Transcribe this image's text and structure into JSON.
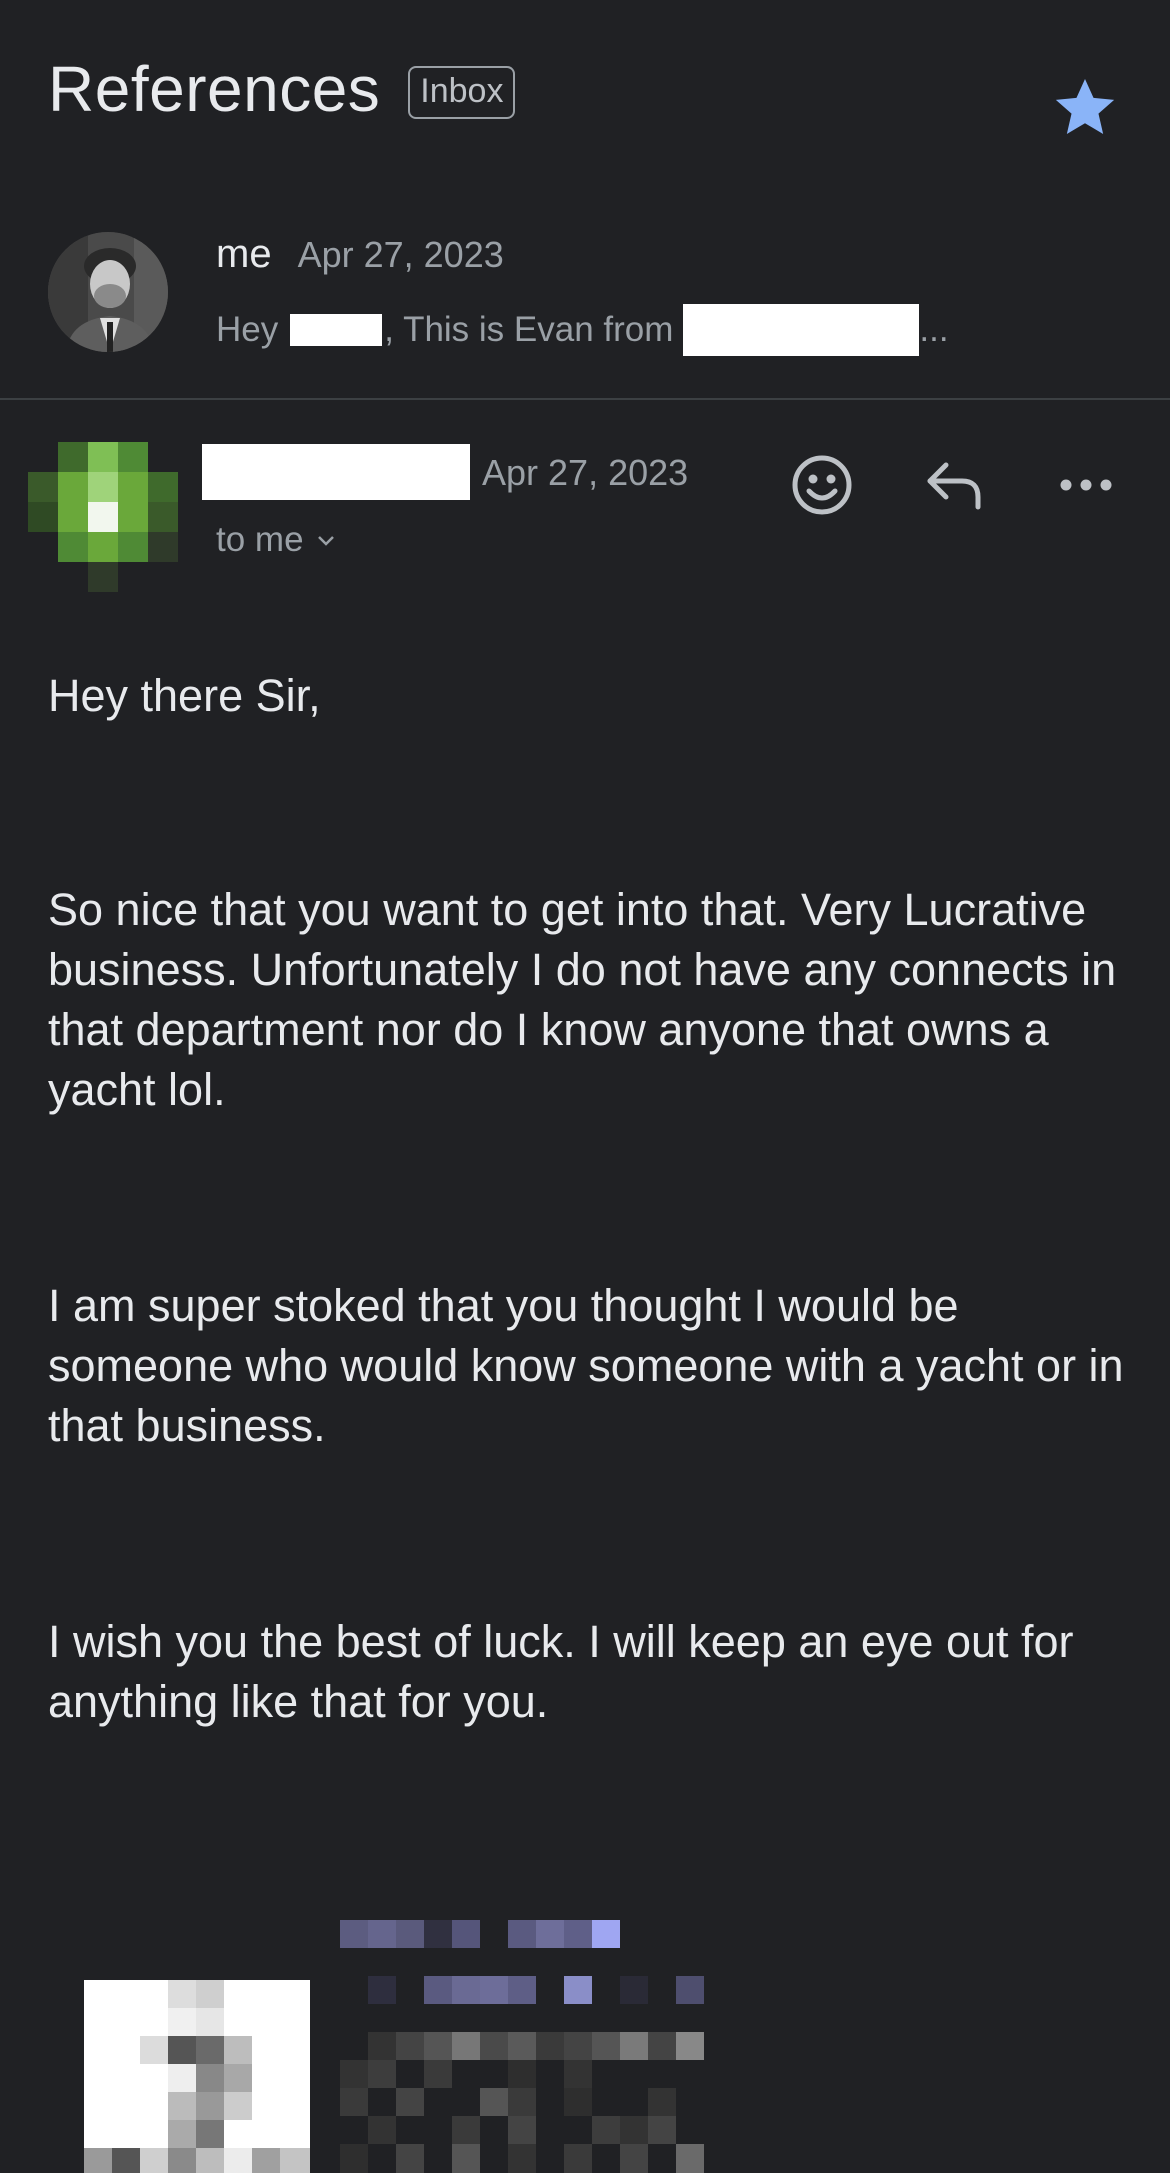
{
  "thread": {
    "subject": "References",
    "label": "Inbox",
    "starred": true,
    "star_color": "#8ab4f8"
  },
  "collapsed_message": {
    "sender": "me",
    "date": "Apr 27, 2023",
    "snippet_prefix": "Hey",
    "snippet_mid": ", This is Evan from",
    "snippet_suffix": "..."
  },
  "expanded_message": {
    "date": "Apr 27, 2023",
    "recipient_line": "to me",
    "avatar_color": "#6aa83a",
    "actions": [
      "emoji-reaction-icon",
      "reply-icon",
      "more-options-icon"
    ],
    "body": [
      "Hey there Sir,",
      "So nice that you want to get into that. Very Lucrative business. Unfortunately I do not have any connects in that department nor do I know anyone that owns a yacht lol.",
      "I am super stoked that you thought I would be someone who would know someone with a yacht or in that business.",
      "I wish you the best of luck. I will keep an eye out for anything like that for you."
    ]
  }
}
